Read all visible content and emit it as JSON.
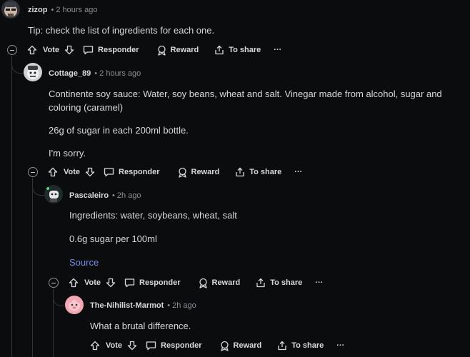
{
  "comments": [
    {
      "username": "zizop",
      "time": "2 hours ago",
      "paragraphs": [
        "Tip: check the list of ingredients for each one."
      ]
    },
    {
      "username": "Cottage_89",
      "time": "2 hours ago",
      "paragraphs": [
        "Continente soy sauce: Water, soy beans, wheat and salt. Vinegar made from alcohol, sugar and coloring (caramel)",
        "26g of sugar in each 200ml bottle.",
        "I'm sorry."
      ]
    },
    {
      "username": "Pascaleiro",
      "time": "2h ago",
      "paragraphs": [
        "Ingredients: water, soybeans, wheat, salt",
        "0.6g sugar per 100ml"
      ],
      "link_text": "Source"
    },
    {
      "username": "The-Nihilist-Marmot",
      "time": "2h ago",
      "paragraphs": [
        "What a brutal difference."
      ]
    }
  ],
  "actions": {
    "vote": "Vote",
    "reply": "Responder",
    "reward": "Reward",
    "share": "To share",
    "more": "···"
  },
  "separator": "•",
  "icons": [
    "collapse-icon",
    "upvote-icon",
    "downvote-icon",
    "comment-icon",
    "award-icon",
    "share-icon",
    "more-icon"
  ],
  "colors": {
    "background": "#0b0c0e",
    "text": "#d7dadc",
    "muted": "#8b8f93",
    "link": "#6e8fe8",
    "thread": "#343536"
  }
}
